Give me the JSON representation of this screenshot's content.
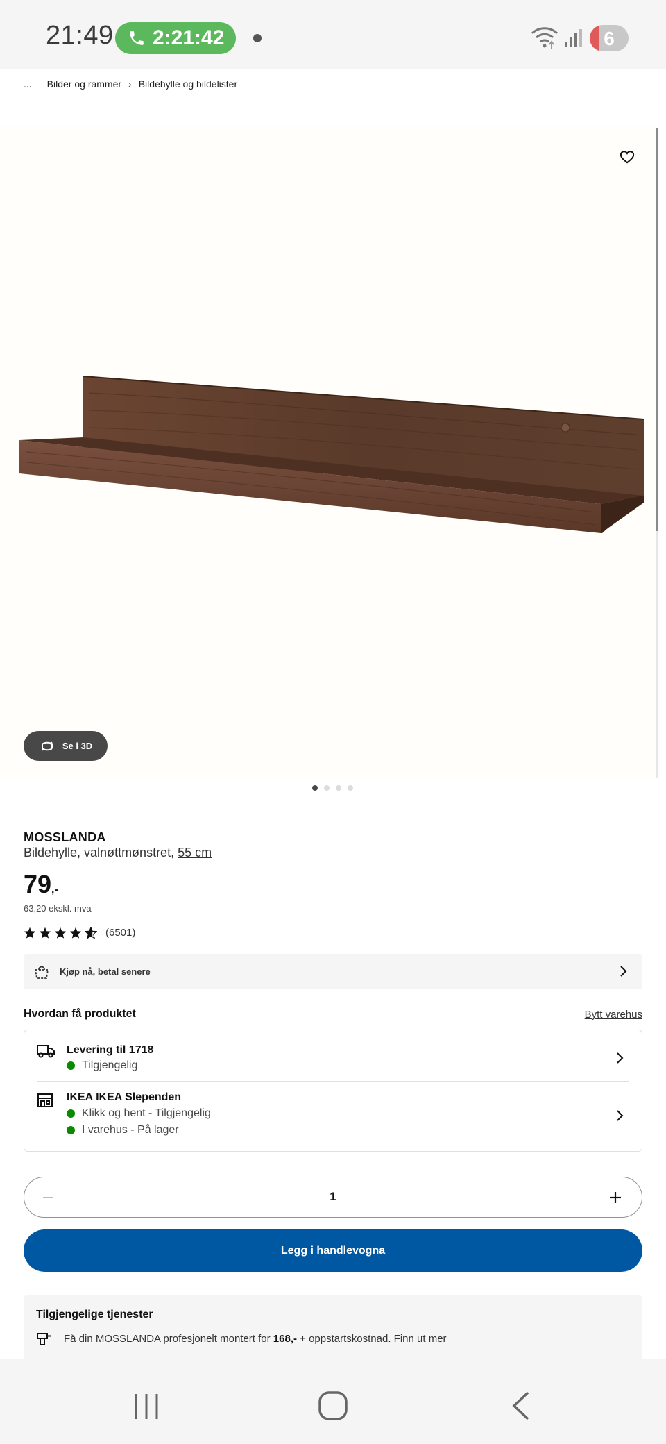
{
  "status_bar": {
    "time": "21:49",
    "call_timer": "2:21:42",
    "battery": "6"
  },
  "breadcrumb": {
    "ellipsis": "...",
    "items": [
      "Bilder og rammer",
      "Bildehylle og bildelister"
    ]
  },
  "gallery": {
    "view_3d_label": "Se i 3D",
    "image_count": 4,
    "active_index": 0
  },
  "product": {
    "name": "MOSSLANDA",
    "description": "Bildehylle, valnøttmønstret, ",
    "size": "55 cm",
    "price": "79",
    "price_suffix": ",-",
    "price_ex_vat": "63,20 ekskl. mva",
    "rating_value": 4.5,
    "rating_count": "(6501)"
  },
  "pay_later": {
    "label": "Kjøp nå, betal senere"
  },
  "availability": {
    "title": "Hvordan få produktet",
    "change_store": "Bytt varehus",
    "delivery": {
      "title": "Levering til 1718",
      "status": "Tilgjengelig"
    },
    "store": {
      "title": "IKEA IKEA Slependen",
      "click_collect": "Klikk og hent - Tilgjengelig",
      "in_store": "I varehus - På lager"
    }
  },
  "quantity": {
    "value": "1"
  },
  "cart": {
    "add_label": "Legg i handlevogna"
  },
  "services": {
    "title": "Tilgjengelige tjenester",
    "text_before": "Få din MOSSLANDA profesjonelt montert for ",
    "price": "168,-",
    "text_after": " + oppstartskostnad. ",
    "link": "Finn ut mer"
  },
  "colors": {
    "primary": "#0058a3",
    "available": "#0a8a00",
    "call": "#5cb85c"
  }
}
